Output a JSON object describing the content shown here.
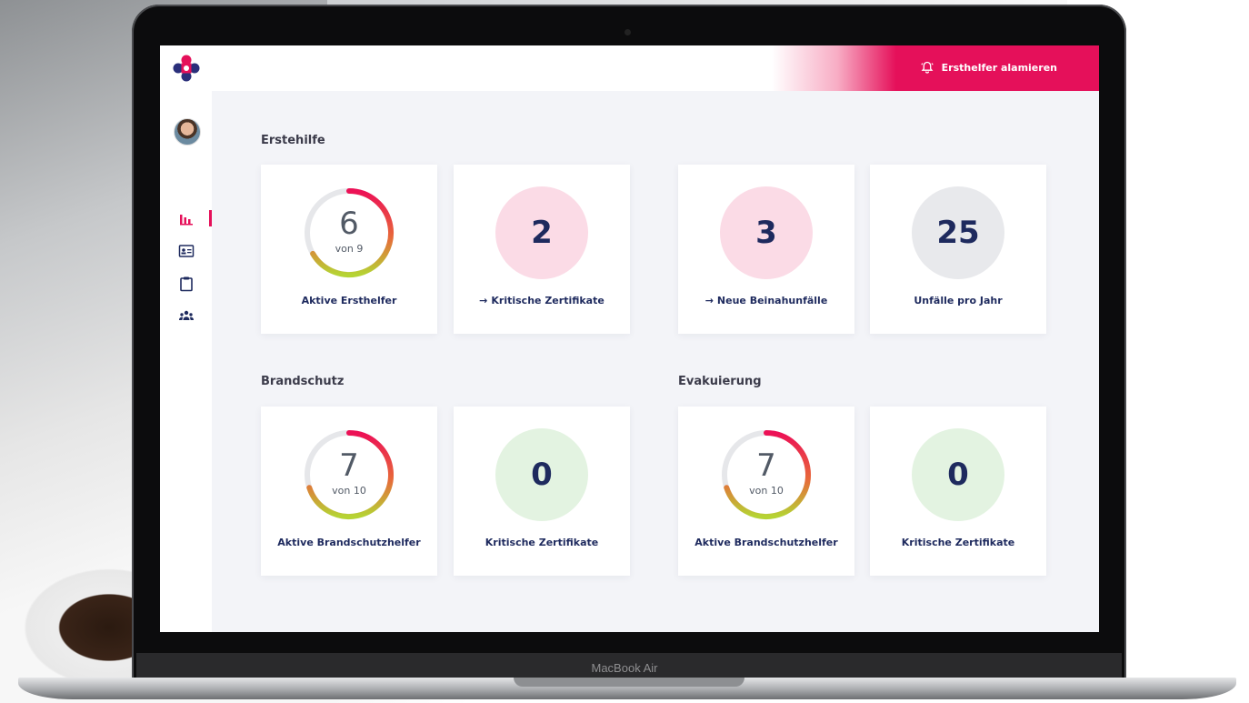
{
  "header": {
    "alert_button": "Ersthelfer alamieren",
    "brand_color": "#e5105a",
    "navy_color": "#1e2a5e"
  },
  "sidebar": {
    "items": [
      {
        "icon": "avatar"
      },
      {
        "icon": "bar-chart-icon",
        "active": true
      },
      {
        "icon": "id-card-icon"
      },
      {
        "icon": "clipboard-icon"
      },
      {
        "icon": "group-icon"
      }
    ]
  },
  "sections": {
    "erstehilfe": {
      "title": "Erstehilfe",
      "aktive": {
        "value": "6",
        "of": "von 9",
        "label": "Aktive Ersthelfer",
        "fraction": 0.667
      },
      "kritische": {
        "value": "2",
        "label": "Kritische Zertifikate",
        "color": "#fbdbe6"
      },
      "beinahunfaelle": {
        "value": "3",
        "label": "Neue Beinahunfälle",
        "color": "#fbdbe6"
      },
      "unfaelle": {
        "value": "25",
        "label": "Unfälle pro Jahr",
        "color": "#e8e9ec"
      }
    },
    "brandschutz": {
      "title": "Brandschutz",
      "aktive": {
        "value": "7",
        "of": "von 10",
        "label": "Aktive Brandschutzhelfer",
        "fraction": 0.7
      },
      "kritische": {
        "value": "0",
        "label": "Kritische Zertifikate",
        "color": "#e3f3e1"
      }
    },
    "evakuierung": {
      "title": "Evakuierung",
      "aktive": {
        "value": "7",
        "of": "von 10",
        "label": "Aktive Brandschutzhelfer",
        "fraction": 0.7
      },
      "kritische": {
        "value": "0",
        "label": "Kritische Zertifikate",
        "color": "#e3f3e1"
      }
    }
  },
  "device": {
    "label": "MacBook Air"
  }
}
